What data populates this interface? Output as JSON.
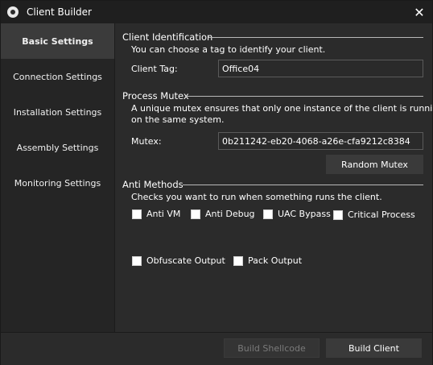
{
  "window": {
    "title": "Client Builder"
  },
  "sidebar": {
    "items": [
      {
        "label": "Basic Settings",
        "active": true
      },
      {
        "label": "Connection Settings",
        "active": false
      },
      {
        "label": "Installation Settings",
        "active": false
      },
      {
        "label": "Assembly Settings",
        "active": false
      },
      {
        "label": "Monitoring Settings",
        "active": false
      }
    ]
  },
  "client_identification": {
    "title": "Client Identification",
    "description": "You can choose a tag to identify your client.",
    "tag_label": "Client Tag:",
    "tag_value": "Office04"
  },
  "process_mutex": {
    "title": "Process Mutex",
    "description_line1": "A unique mutex ensures that only one instance of the client is running",
    "description_line2": "on the same system.",
    "mutex_label": "Mutex:",
    "mutex_value": "0b211242-eb20-4068-a26e-cfa9212c8384",
    "random_button": "Random Mutex"
  },
  "anti_methods": {
    "title": "Anti Methods",
    "description": "Checks you want to run when something runs the client.",
    "options": [
      {
        "label": "Anti VM",
        "checked": false
      },
      {
        "label": "Anti Debug",
        "checked": false
      },
      {
        "label": "UAC Bypass",
        "checked": false
      },
      {
        "label": "Critical Process",
        "checked": false
      }
    ]
  },
  "output_options": [
    {
      "label": "Obfuscate Output",
      "checked": false
    },
    {
      "label": "Pack Output",
      "checked": false
    }
  ],
  "footer": {
    "build_shellcode": "Build Shellcode",
    "build_client": "Build Client"
  }
}
